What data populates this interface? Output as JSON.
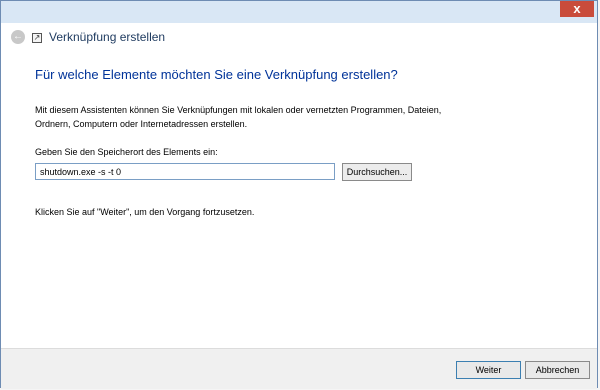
{
  "window": {
    "close_label": "x"
  },
  "header": {
    "title": "Verknüpfung erstellen",
    "back_icon": "back-arrow-icon",
    "app_icon": "shortcut-icon"
  },
  "content": {
    "heading": "Für welche Elemente möchten Sie eine Verknüpfung erstellen?",
    "description": "Mit diesem Assistenten können Sie Verknüpfungen mit lokalen oder vernetzten Programmen, Dateien, Ordnern, Computern oder Internetadressen erstellen.",
    "field_label": "Geben Sie den Speicherort des Elements ein:",
    "location_value": "shutdown.exe -s -t 0",
    "browse_label": "Durchsuchen...",
    "hint": "Klicken Sie auf \"Weiter\", um den Vorgang fortzusetzen."
  },
  "footer": {
    "next_label": "Weiter",
    "cancel_label": "Abbrechen"
  },
  "colors": {
    "heading": "#003399",
    "close": "#c94c3b",
    "titlebar": "#d9e7f5"
  }
}
